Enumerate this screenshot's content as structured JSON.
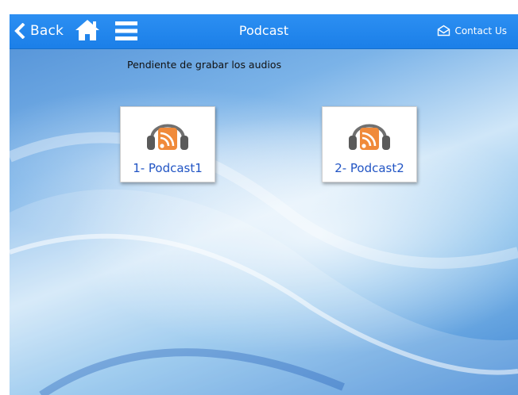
{
  "navbar": {
    "back_label": "Back",
    "title": "Podcast",
    "contact_label": "Contact Us",
    "back_icon": "chevron-left-icon",
    "home_icon": "home-icon",
    "menu_icon": "hamburger-menu-icon",
    "contact_icon": "envelope-icon",
    "bar_color": "#2288ee"
  },
  "main": {
    "notice": "Pendiente de grabar los audios",
    "podcasts": [
      {
        "label": "1- Podcast1",
        "icon": "headphones-rss-icon"
      },
      {
        "label": "2- Podcast2",
        "icon": "headphones-rss-icon"
      }
    ],
    "label_color": "#2255c4",
    "rss_color": "#f08a3a"
  }
}
